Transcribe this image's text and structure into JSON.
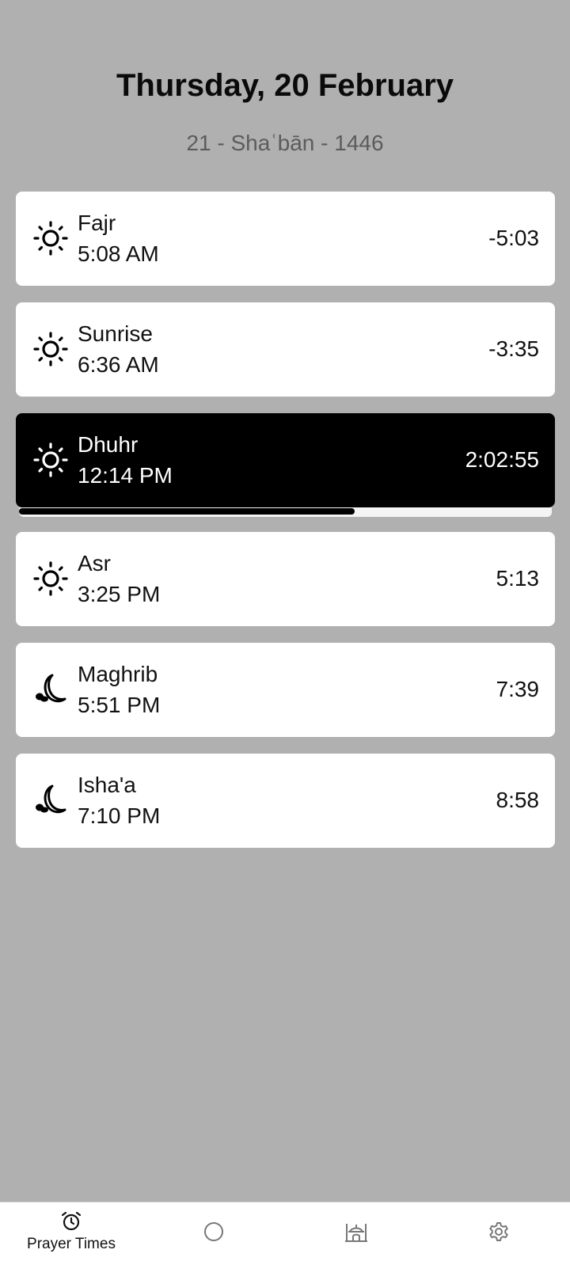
{
  "header": {
    "date": "Thursday, 20 February",
    "hijri": "21 - Shaʿbān - 1446"
  },
  "prayers": [
    {
      "name": "Fajr",
      "time": "5:08 AM",
      "countdown": "-5:03",
      "icon": "sun-icon"
    },
    {
      "name": "Sunrise",
      "time": "6:36 AM",
      "countdown": "-3:35",
      "icon": "sun-icon"
    },
    {
      "name": "Dhuhr",
      "time": "12:14 PM",
      "countdown": "2:02:55",
      "icon": "sun-icon",
      "active": true,
      "progress": 0.63
    },
    {
      "name": "Asr",
      "time": "3:25 PM",
      "countdown": "5:13",
      "icon": "sun-icon"
    },
    {
      "name": "Maghrib",
      "time": "5:51 PM",
      "countdown": "7:39",
      "icon": "moon-icon"
    },
    {
      "name": "Isha'a",
      "time": "7:10 PM",
      "countdown": "8:58",
      "icon": "moon-icon"
    }
  ],
  "nav": {
    "items": [
      {
        "label": "Prayer Times",
        "icon": "alarm-clock-icon",
        "selected": true
      },
      {
        "label": "",
        "icon": "circle-icon"
      },
      {
        "label": "",
        "icon": "mosque-icon"
      },
      {
        "label": "",
        "icon": "gear-icon"
      }
    ]
  },
  "colors": {
    "background": "#b0b0b0",
    "card": "#ffffff",
    "active_card": "#000000",
    "hijri_text": "#5c5c5c"
  }
}
